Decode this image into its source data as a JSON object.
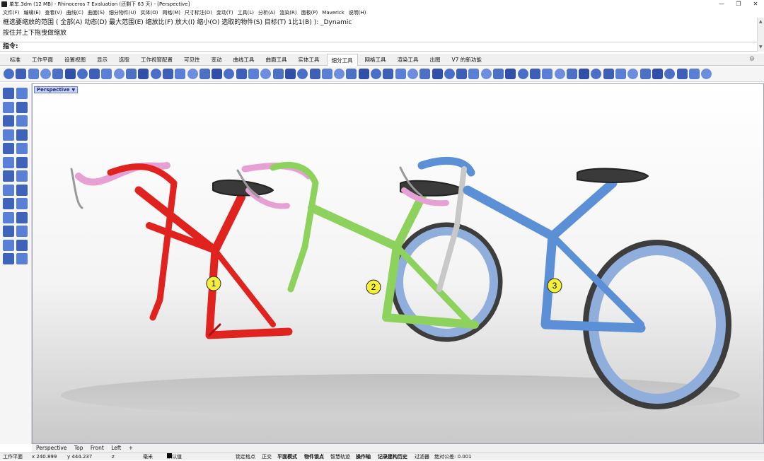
{
  "window": {
    "title": "单车.3dm (12 MB) - Rhinoceros 7 Evaluation (还剩下 63 天) - [Perspective]",
    "controls": [
      "—",
      "❐",
      "✕"
    ]
  },
  "menu": [
    "文件(F)",
    "编辑(E)",
    "查看(V)",
    "曲线(C)",
    "曲面(S)",
    "细分物件(U)",
    "实体(O)",
    "网格(M)",
    "尺寸标注(D)",
    "变动(T)",
    "工具(L)",
    "分析(A)",
    "渲染(R)",
    "面板(P)",
    "Maverick",
    "说明(H)"
  ],
  "command_history": {
    "line1": "框选要缩放的范围 ( 全部(A) 动态(D) 最大范围(E) 缩放比(F) 放大(I) 缩小(O) 选取的物件(S) 目标(T) 1比1(B) ): _Dynamic",
    "line2": "按住并上下拖曳做缩放",
    "prompt": "指令:"
  },
  "tabs": [
    "标准",
    "工作平面",
    "设置视图",
    "显示",
    "选取",
    "工作视窗配置",
    "可见性",
    "变动",
    "曲线工具",
    "曲面工具",
    "实体工具",
    "细分工具",
    "网格工具",
    "渲染工具",
    "出图",
    "V7 的新功能"
  ],
  "active_tab": "细分工具",
  "viewport": {
    "label": "Perspective",
    "markers": [
      "1",
      "2",
      "3"
    ],
    "colors": {
      "red": "#e0231f",
      "green": "#8ed25e",
      "blue": "#5b8fd6",
      "pink": "#e59ad0",
      "seat": "#3a3a3a"
    }
  },
  "view_tabs": [
    "Perspective",
    "Top",
    "Front",
    "Left",
    "+"
  ],
  "status": {
    "cplane": "工作平面",
    "x": "x 240.899",
    "y": "y 444.237",
    "z": "z",
    "unit": "毫米",
    "layer": "默认值",
    "items": [
      "锁定格点",
      "正交",
      "平面模式",
      "物件锁点",
      "智慧轨迹",
      "操作轴",
      "记录建构历史",
      "过滤器",
      "绝对公差: 0.001"
    ]
  }
}
